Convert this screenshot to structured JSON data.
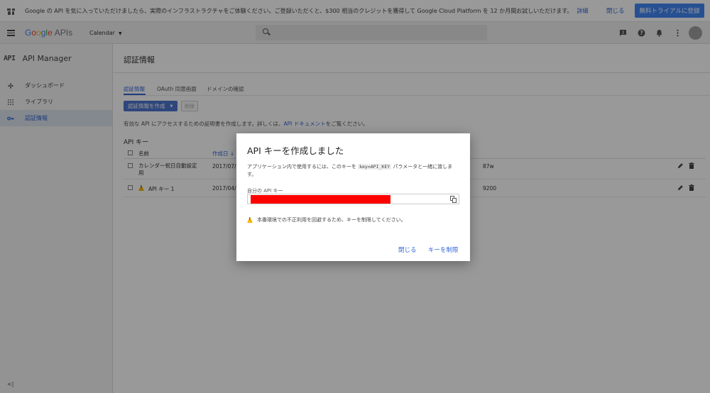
{
  "promo": {
    "text": "Google の API を気に入っていただけましたら、実際のインフラストラクチャをご体験ください。ご登録いただくと、$300 相当のクレジットを獲得して Google Cloud Platform を 12 か月間お試しいただけます。",
    "details_link": "詳細",
    "close_label": "閉じる",
    "trial_label": "無料トライアルに登録"
  },
  "header": {
    "logo_google": "Google",
    "logo_apis": "APIs",
    "project": "Calendar"
  },
  "sidebar": {
    "title": "API Manager",
    "badge": "API",
    "items": [
      {
        "label": "ダッシュボード",
        "icon": "dashboard-icon"
      },
      {
        "label": "ライブラリ",
        "icon": "library-icon"
      },
      {
        "label": "認証情報",
        "icon": "key-icon"
      }
    ],
    "collapse": "<|"
  },
  "main": {
    "title": "認証情報",
    "tabs": [
      "認証情報",
      "OAuth 同意画面",
      "ドメインの確認"
    ],
    "create_button": "認証情報を作成",
    "delete_button": "削除",
    "desc_prefix": "有効な API にアクセスするための証明書を作成します。詳しくは、",
    "desc_link": "API ドキュメント",
    "desc_suffix": "をご覧ください。",
    "section_title": "API キー",
    "columns": {
      "name": "名前",
      "created": "作成日"
    },
    "rows": [
      {
        "name_line1": "カレンダー祝日自動設定",
        "name_line2": "用",
        "created": "2017/07/",
        "key_tail": "87w",
        "warning": false
      },
      {
        "name_line1": "API キー 1",
        "name_line2": "",
        "created": "2017/04/",
        "key_tail": "9200",
        "warning": true
      }
    ]
  },
  "dialog": {
    "title": "API キーを作成しました",
    "desc_before": "アプリケーション内で使用するには、このキーを ",
    "desc_code": "key=API_KEY",
    "desc_after": " パラメータと一緒に渡します。",
    "key_label": "自分の API キー",
    "warning": "本番環境での不正利用を回避するため、キーを制限してください。",
    "close_button": "閉じる",
    "restrict_button": "キーを制限"
  },
  "colors": {
    "accent": "#4285f4",
    "link": "#3367d6",
    "warning": "#f4b400",
    "redaction": "#ff0000"
  }
}
